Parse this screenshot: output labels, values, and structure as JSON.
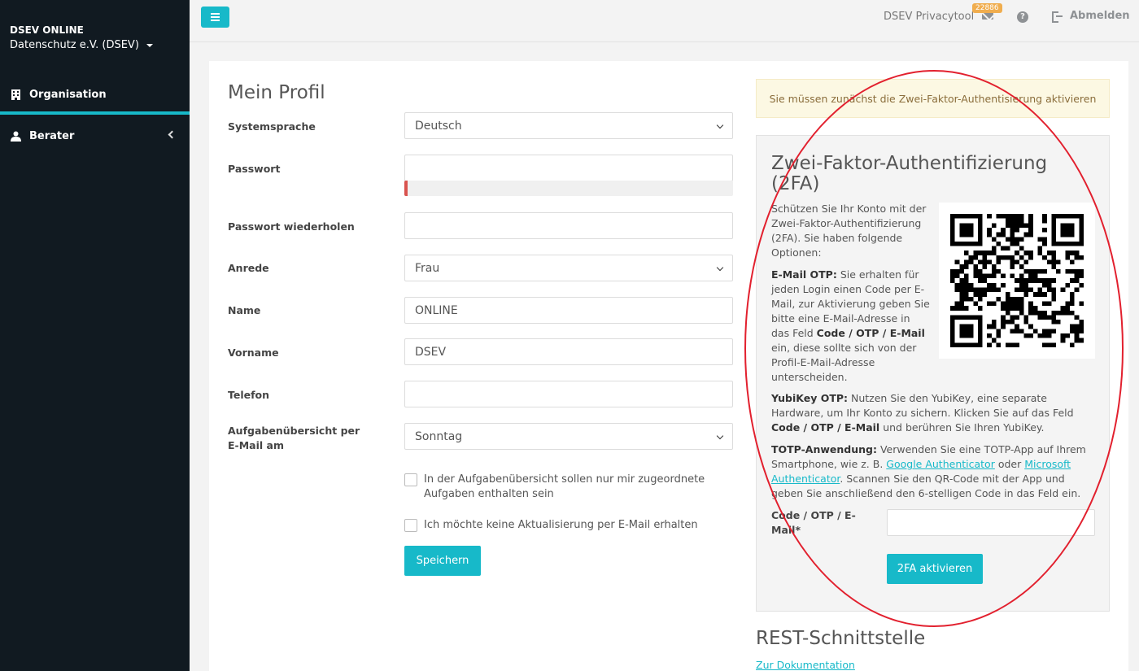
{
  "sidebar": {
    "org_name": "DSEV ONLINE",
    "org_sub": "Datenschutz e.V. (DSEV)",
    "items": [
      {
        "label": "Organisation",
        "icon": "building-icon"
      },
      {
        "label": "Berater",
        "icon": "user-icon"
      }
    ]
  },
  "topbar": {
    "title": "DSEV Privacytool",
    "badge_count": "22886",
    "logout_label": "Abmelden"
  },
  "profile": {
    "title": "Mein Profil",
    "fields": {
      "language": {
        "label": "Systemsprache",
        "value": "Deutsch"
      },
      "password": {
        "label": "Passwort",
        "value": "",
        "strength": 0.01
      },
      "password_repeat": {
        "label": "Passwort wiederholen",
        "value": ""
      },
      "salutation": {
        "label": "Anrede",
        "value": "Frau"
      },
      "name": {
        "label": "Name",
        "value": "ONLINE"
      },
      "firstname": {
        "label": "Vorname",
        "value": "DSEV"
      },
      "phone": {
        "label": "Telefon",
        "value": ""
      },
      "task_overview": {
        "label": "Aufgabenübersicht per E-Mail am",
        "value": "Sonntag"
      }
    },
    "checkboxes": [
      {
        "label": "In der Aufgabenübersicht sollen nur mir zugeordnete Aufgaben enthalten sein",
        "checked": false
      },
      {
        "label": "Ich möchte keine Aktualisierung per E-Mail erhalten",
        "checked": false
      }
    ],
    "save_label": "Speichern"
  },
  "alert": {
    "text": "Sie müssen zunächst die Zwei-Faktor-Authentisierung aktivieren"
  },
  "tfa": {
    "title": "Zwei-Faktor-Authentifizierung (2FA)",
    "intro": "Schützen Sie Ihr Konto mit der Zwei-Faktor-Authentifizierung (2FA). Sie haben folgende Optionen:",
    "email_otp": {
      "head": "E-Mail OTP:",
      "text1": " Sie erhalten für jeden Login einen Code per E-Mail, zur Aktivierung geben Sie bitte eine E-Mail-Adresse in das Feld ",
      "field": "Code / OTP / E-Mail",
      "text2": " ein, diese sollte sich von der Profil-E-Mail-Adresse unterscheiden."
    },
    "yubikey": {
      "head": "YubiKey OTP:",
      "text1": " Nutzen Sie den YubiKey, eine separate Hardware, um Ihr Konto zu sichern. Klicken Sie auf das Feld ",
      "field": "Code / OTP / E-Mail",
      "text2": " und berühren Sie Ihren YubiKey."
    },
    "totp": {
      "head": "TOTP-Anwendung:",
      "text1": " Verwenden Sie eine TOTP-App auf Ihrem Smartphone, wie z. B. ",
      "link1": "Google Authenticator",
      "text2": " oder ",
      "link2": "Microsoft Authenticator",
      "text3": ". Scannen Sie den QR-Code mit der App und geben Sie anschließend den 6-stelligen Code in das Feld ein."
    },
    "code_label": "Code / OTP / E-Mail*",
    "activate_label": "2FA aktivieren"
  },
  "rest": {
    "title": "REST-Schnittstelle",
    "link": "Zur Dokumentation"
  },
  "colors": {
    "accent": "#17b9c9",
    "sidebar_bg": "#111a21",
    "alert_bg": "#fcf8e3",
    "annotation": "#e2202e"
  }
}
